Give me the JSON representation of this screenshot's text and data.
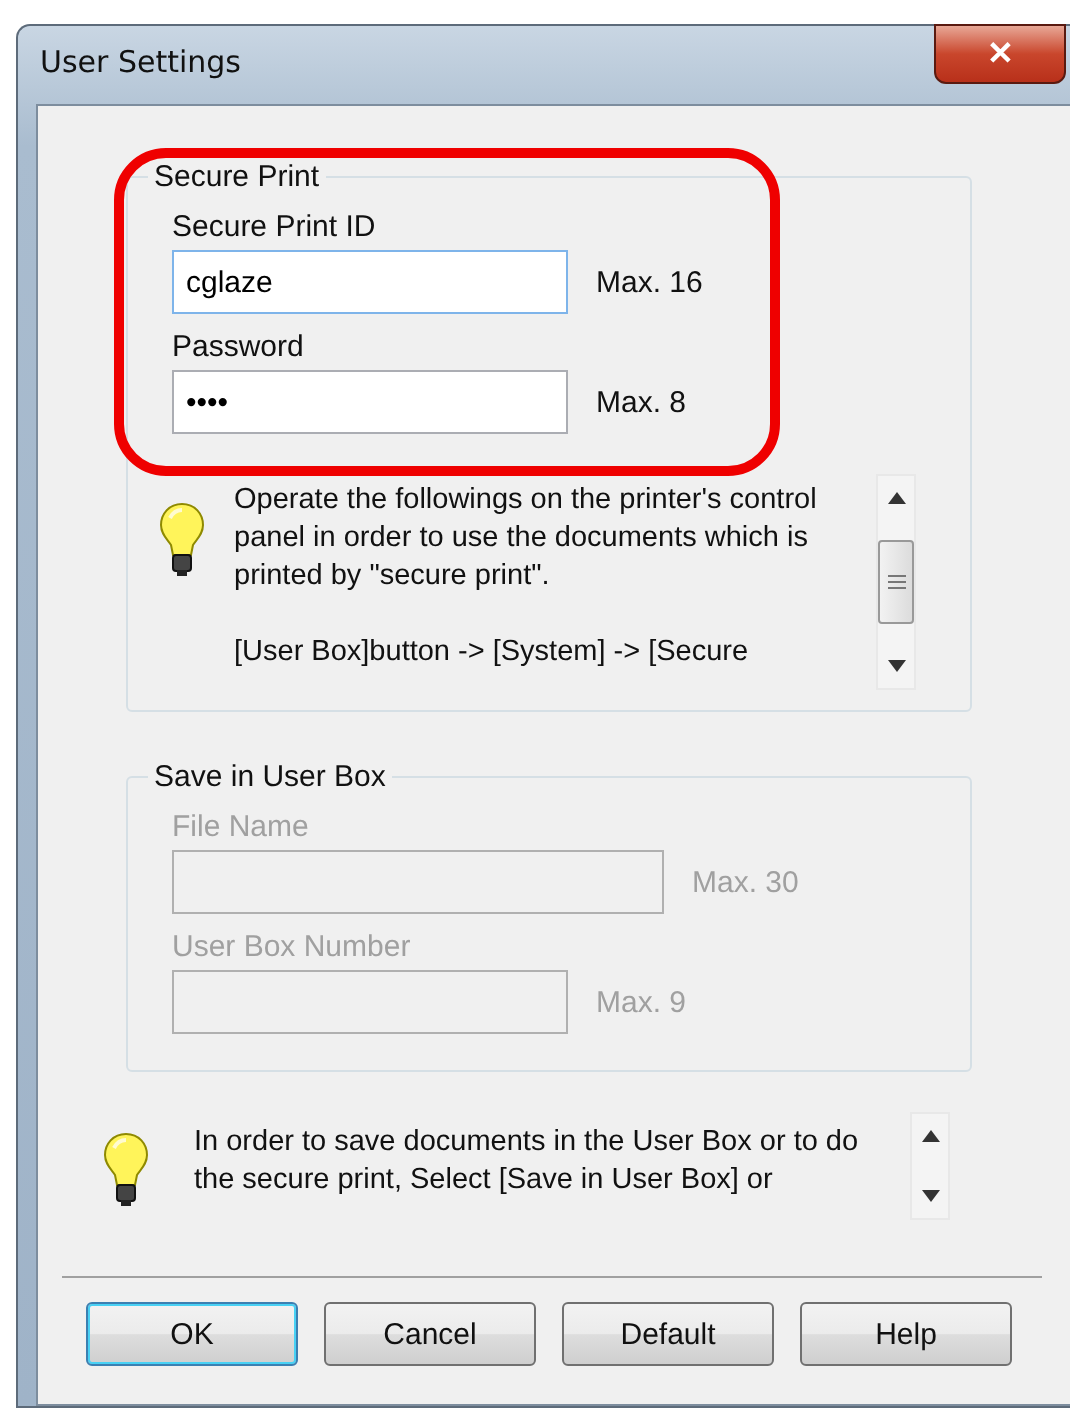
{
  "window": {
    "title": "User Settings",
    "close": "✕"
  },
  "secure_print": {
    "legend": "Secure Print",
    "fields": [
      {
        "label": "Secure Print ID",
        "value": "cglaze",
        "limit": "Max. 16",
        "disabled": false,
        "wide": false
      },
      {
        "label": "Password",
        "value": "••••",
        "limit": "Max. 8",
        "disabled": false,
        "wide": false
      }
    ],
    "hint": "Operate the followings on the printer's control\npanel in order to use the documents which is\nprinted by \"secure print\".\n\n[User Box]button -> [System] -> [Secure"
  },
  "save_in_user_box": {
    "legend": "Save in User Box",
    "fields": [
      {
        "label": "File Name",
        "limit": "Max. 30",
        "disabled": true,
        "wide": true
      },
      {
        "label": "User Box Number",
        "limit": "Max. 9",
        "disabled": true,
        "wide": false
      }
    ]
  },
  "hint": "In order to save documents in the User Box or to do\nthe secure print, Select [Save in User Box] or",
  "buttons": [
    {
      "label": "OK",
      "default": true
    },
    {
      "label": "Cancel",
      "default": false
    },
    {
      "label": "Default",
      "default": false
    },
    {
      "label": "Help",
      "default": false
    }
  ]
}
